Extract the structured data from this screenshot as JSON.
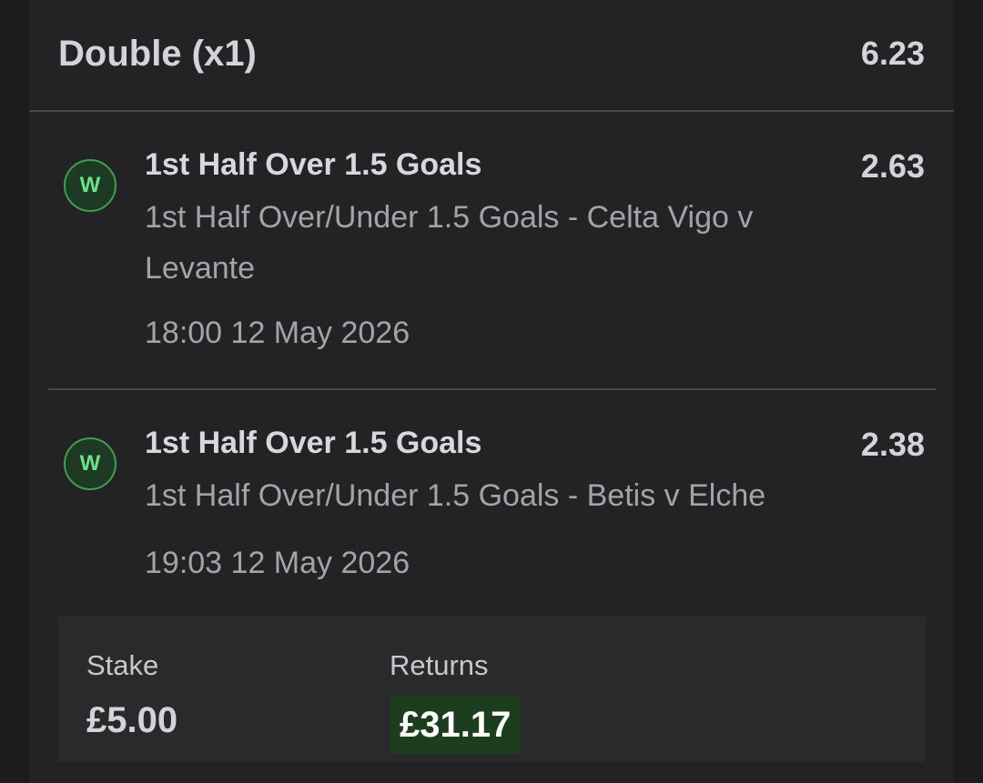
{
  "bet": {
    "title": "Double (x1)",
    "total_odds": "6.23"
  },
  "legs": [
    {
      "status": "W",
      "selection": "1st Half Over 1.5 Goals",
      "odds": "2.63",
      "market": "1st Half Over/Under 1.5 Goals - Celta Vigo v Levante",
      "datetime": "18:00 12 May 2026"
    },
    {
      "status": "W",
      "selection": "1st Half Over 1.5 Goals",
      "odds": "2.38",
      "market": "1st Half Over/Under 1.5 Goals - Betis v Elche",
      "datetime": "19:03 12 May 2026"
    }
  ],
  "summary": {
    "stake_label": "Stake",
    "stake_value": "£5.00",
    "returns_label": "Returns",
    "returns_value": "£31.17"
  },
  "colors": {
    "background": "#1c1c1e",
    "panel": "#232325",
    "win_badge_border": "#3f9e52",
    "win_badge_text": "#6fe08a",
    "returns_highlight": "#1d3d1f"
  }
}
